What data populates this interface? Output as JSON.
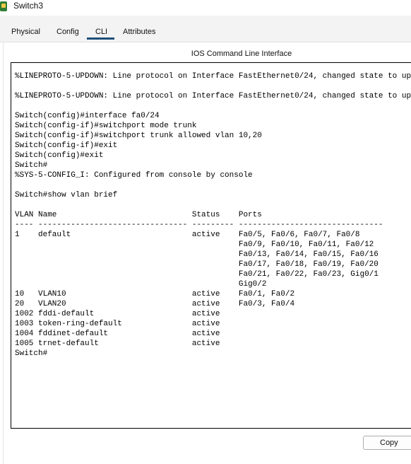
{
  "window": {
    "title": "Switch3"
  },
  "tabs": [
    {
      "label": "Physical"
    },
    {
      "label": "Config"
    },
    {
      "label": "CLI",
      "active": true
    },
    {
      "label": "Attributes"
    }
  ],
  "panel": {
    "title": "IOS Command Line Interface"
  },
  "terminal": {
    "text": "%LINEPROTO-5-UPDOWN: Line protocol on Interface FastEthernet0/24, changed state to up\n\n%LINEPROTO-5-UPDOWN: Line protocol on Interface FastEthernet0/24, changed state to up\n\nSwitch(config)#interface fa0/24\nSwitch(config-if)#switchport mode trunk\nSwitch(config-if)#switchport trunk allowed vlan 10,20\nSwitch(config-if)#exit\nSwitch(config)#exit\nSwitch#\n%SYS-5-CONFIG_I: Configured from console by console\n\nSwitch#show vlan brief\n\nVLAN Name                             Status    Ports\n---- -------------------------------- --------- -------------------------------\n1    default                          active    Fa0/5, Fa0/6, Fa0/7, Fa0/8\n                                                Fa0/9, Fa0/10, Fa0/11, Fa0/12\n                                                Fa0/13, Fa0/14, Fa0/15, Fa0/16\n                                                Fa0/17, Fa0/18, Fa0/19, Fa0/20\n                                                Fa0/21, Fa0/22, Fa0/23, Gig0/1\n                                                Gig0/2\n10   VLAN10                           active    Fa0/1, Fa0/2\n20   VLAN20                           active    Fa0/3, Fa0/4\n1002 fddi-default                     active    \n1003 token-ring-default               active    \n1004 fddinet-default                  active    \n1005 trnet-default                    active    \nSwitch#"
  },
  "buttons": {
    "copy": "Copy"
  },
  "colors": {
    "active_tab_underline": "#1f4e79",
    "app_icon": "#2e7d32"
  }
}
